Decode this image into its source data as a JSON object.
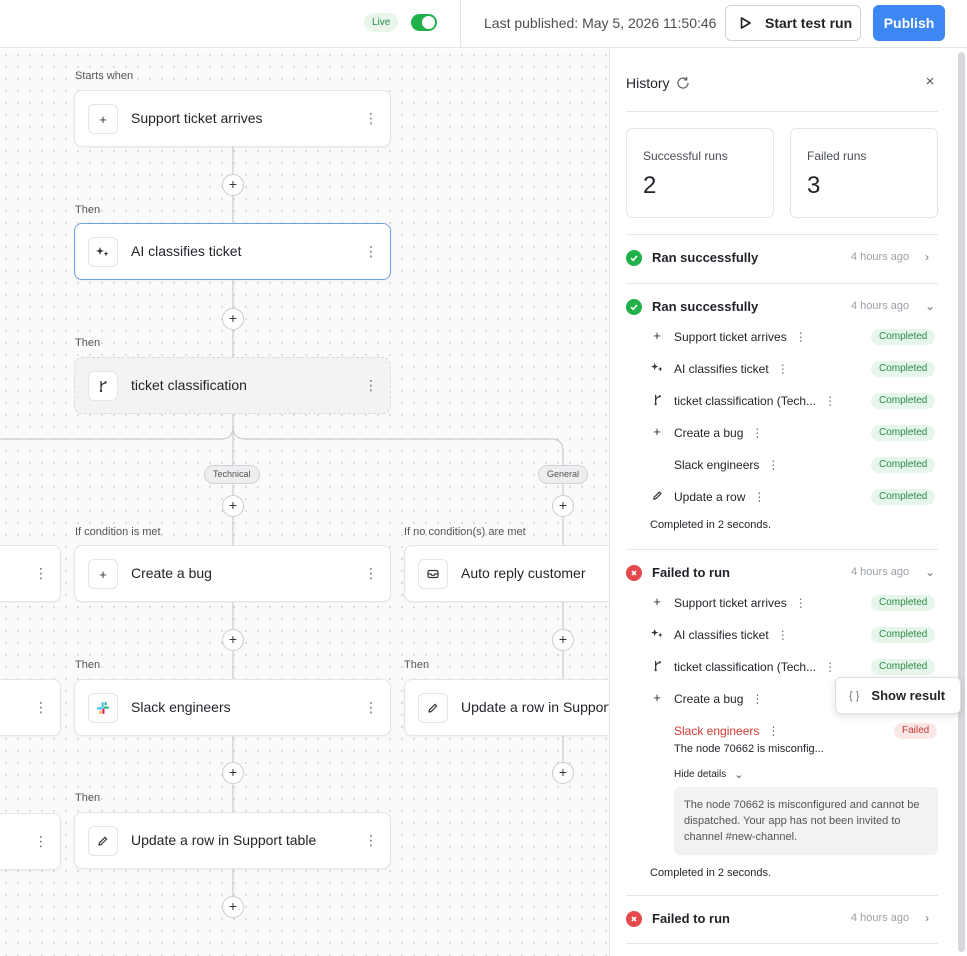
{
  "topbar": {
    "live_badge": "Live",
    "live_toggle_on": true,
    "last_published": "Last published: May 5, 2026 11:50:46",
    "start_test_run": "Start test run",
    "publish": "Publish"
  },
  "canvas": {
    "captions": {
      "starts_when": "Starts when",
      "then_1": "Then",
      "then_2": "Then",
      "if_condition": "If condition is met",
      "if_no_condition": "If no condition(s) are met",
      "then_3": "Then",
      "then_4": "Then",
      "then_5": "Then"
    },
    "branch_pills": {
      "technical": "Technical",
      "general": "General"
    },
    "nodes": {
      "trigger": {
        "label": "Support ticket arrives",
        "icon": "plus-icon"
      },
      "ai": {
        "label": "AI classifies ticket",
        "icon": "sparkle-icon"
      },
      "router": {
        "label": "ticket classification",
        "icon": "branch-icon"
      },
      "create_bug": {
        "label": "Create a bug",
        "icon": "plus-icon"
      },
      "auto_reply": {
        "label": "Auto reply customer",
        "icon": "inbox-icon"
      },
      "slack": {
        "label": "Slack engineers",
        "icon": "slack-icon"
      },
      "update_row_right": {
        "label": "Update a row in Support",
        "icon": "pencil-icon"
      },
      "update_row": {
        "label": "Update a row in Support table",
        "icon": "pencil-icon"
      }
    },
    "menu_glyph": "⋮",
    "plus_glyph": "+"
  },
  "history": {
    "title": "History",
    "close": "×",
    "stats": {
      "successful_label": "Successful runs",
      "successful_value": "2",
      "failed_label": "Failed runs",
      "failed_value": "3"
    },
    "runs": [
      {
        "status": "Ran successfully",
        "time": "4 hours ago"
      },
      {
        "status": "Ran successfully",
        "time": "4 hours ago",
        "steps": [
          {
            "label": "Support ticket arrives",
            "badge": "Completed"
          },
          {
            "label": "AI classifies ticket",
            "badge": "Completed"
          },
          {
            "label": "ticket classification (Tech...",
            "badge": "Completed"
          },
          {
            "label": "Create a bug",
            "badge": "Completed"
          },
          {
            "label": "Slack engineers",
            "badge": "Completed"
          },
          {
            "label": "Update a row",
            "badge": "Completed"
          }
        ],
        "completed_in": "Completed in 2 seconds."
      },
      {
        "status": "Failed to run",
        "time": "4 hours ago",
        "steps": [
          {
            "label": "Support ticket arrives",
            "badge": "Completed"
          },
          {
            "label": "AI classifies ticket",
            "badge": "Completed"
          },
          {
            "label": "ticket classification (Tech...",
            "badge": "Completed"
          },
          {
            "label": "Create a bug"
          },
          {
            "label": "Slack engineers",
            "badge": "Failed"
          }
        ],
        "error_short": "The node 70662 is misconfig...",
        "hide_details": "Hide details",
        "error_full": "The node 70662 is misconfigured and cannot be dispatched. Your app has not been invited to channel #new-channel.",
        "completed_in": "Completed in 2 seconds."
      },
      {
        "status": "Failed to run",
        "time": "4 hours ago"
      }
    ],
    "tooltip": {
      "icon": "{ }",
      "label": "Show result"
    }
  },
  "colors": {
    "accent": "#3d87f5",
    "success": "#22b04b",
    "error": "#e5484d",
    "selected_border": "#6f9fe8"
  }
}
